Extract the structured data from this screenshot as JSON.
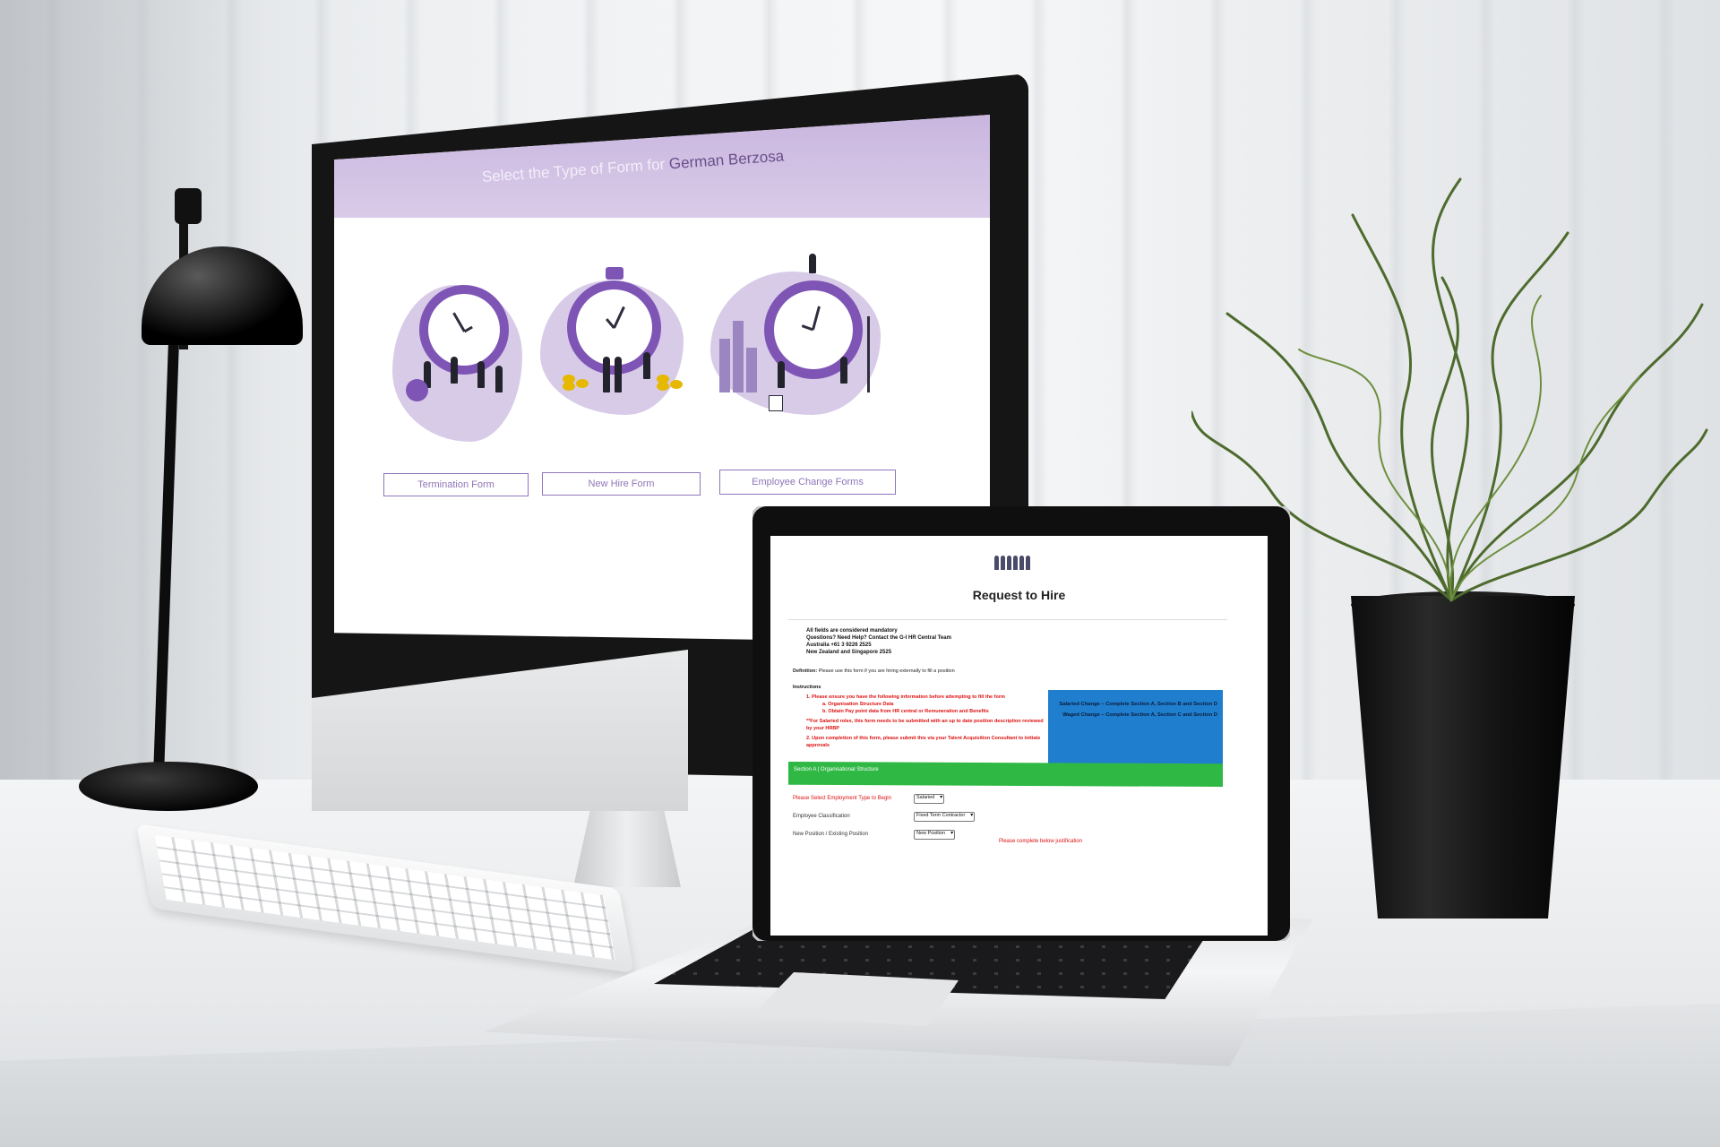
{
  "monitor": {
    "header_prefix": "Select the Type of Form for ",
    "header_name": "German Berzosa",
    "buttons": {
      "termination": "Termination Form",
      "new_hire": "New Hire Form",
      "employee_change": "Employee Change Forms"
    },
    "colors": {
      "header": "#d9cbe8",
      "accent": "#7e55b5",
      "button_border": "#8e76b8"
    }
  },
  "laptop": {
    "title": "Request to Hire",
    "info": [
      "All fields are considered mandatory",
      "Questions? Need Help? Contact the G-I HR Central Team",
      "Australia +61 3 9226 2525",
      "New Zealand and Singapore 2525"
    ],
    "definition_label": "Definition:",
    "definition_text": " Please use this form if you are hiring externally to fill a position",
    "instructions_label": "Instructions",
    "instructions": {
      "item1": "1. Please ensure you have the following information before attempting to fill the form",
      "item1a": "a. Organisation Structure Data",
      "item1b": "b. Obtain Pay point data from HR central or Remuneration and Benefits",
      "note": "**For Salaried roles, this form needs to be submitted with an up to date position description reviewed by your HRBP",
      "item2": "2. Upon completion of this form, please submit this via your Talent Acquisition Consultant to initiate approvals"
    },
    "blue_box": {
      "line1": "Salaried Change – Complete Section A, Section B and Section D",
      "line2": "Waged Change – Complete Section A, Section C and Section D"
    },
    "section_a": "Section A | Organisational Structure",
    "rows": {
      "employment_type_label": "Please Select Employment Type to Begin",
      "employment_type_value": "Salaried",
      "classification_label": "Employee Classification",
      "classification_value": "Fixed Term Contractor",
      "position_label": "New Position / Existing Position",
      "position_value": "New Position",
      "justification": "Please complete below justification"
    },
    "colors": {
      "section_bar": "#2fb844",
      "info_box": "#1f7fce",
      "warning": "#dd1111"
    }
  },
  "icons": [
    "lamp",
    "keyboard",
    "plant",
    "clock-illustration",
    "company-logo-icon"
  ]
}
